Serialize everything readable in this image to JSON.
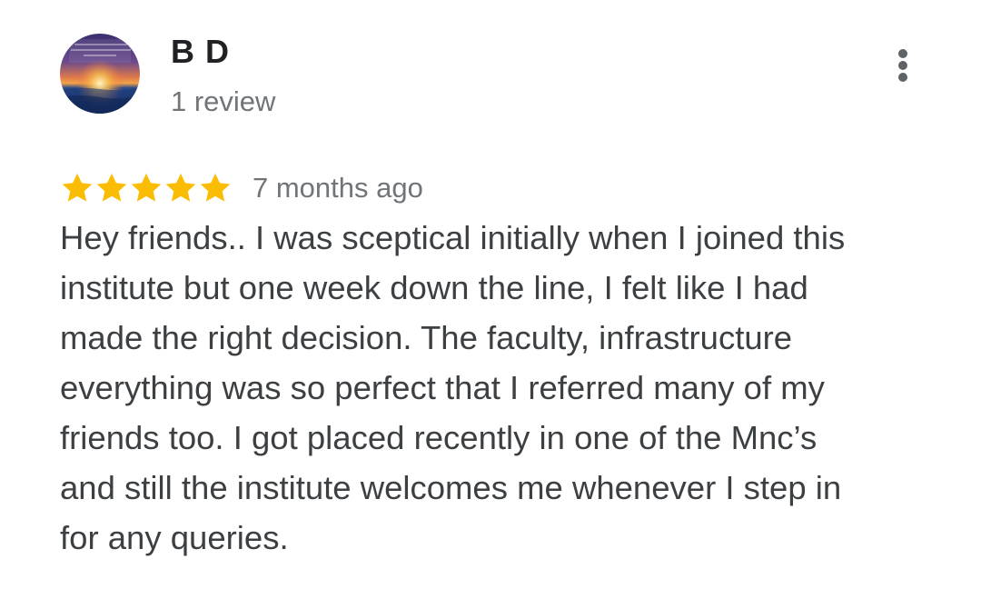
{
  "reviewer": {
    "name": "B D",
    "review_count": "1 review",
    "avatar_icon": "sunset-avatar-image"
  },
  "menu": {
    "icon": "more-vert-icon"
  },
  "review": {
    "rating": 5,
    "max_rating": 5,
    "star_color": "#fbbc04",
    "time": "7 months ago",
    "text": "Hey friends.. I was sceptical initially when I joined this institute but one week down the line, I felt like I had made the right decision. The faculty, infrastructure everything was so perfect that I referred many of my friends too. I got placed recently in one of the Mnc’s and still the institute welcomes me whenever I step in for any queries."
  }
}
